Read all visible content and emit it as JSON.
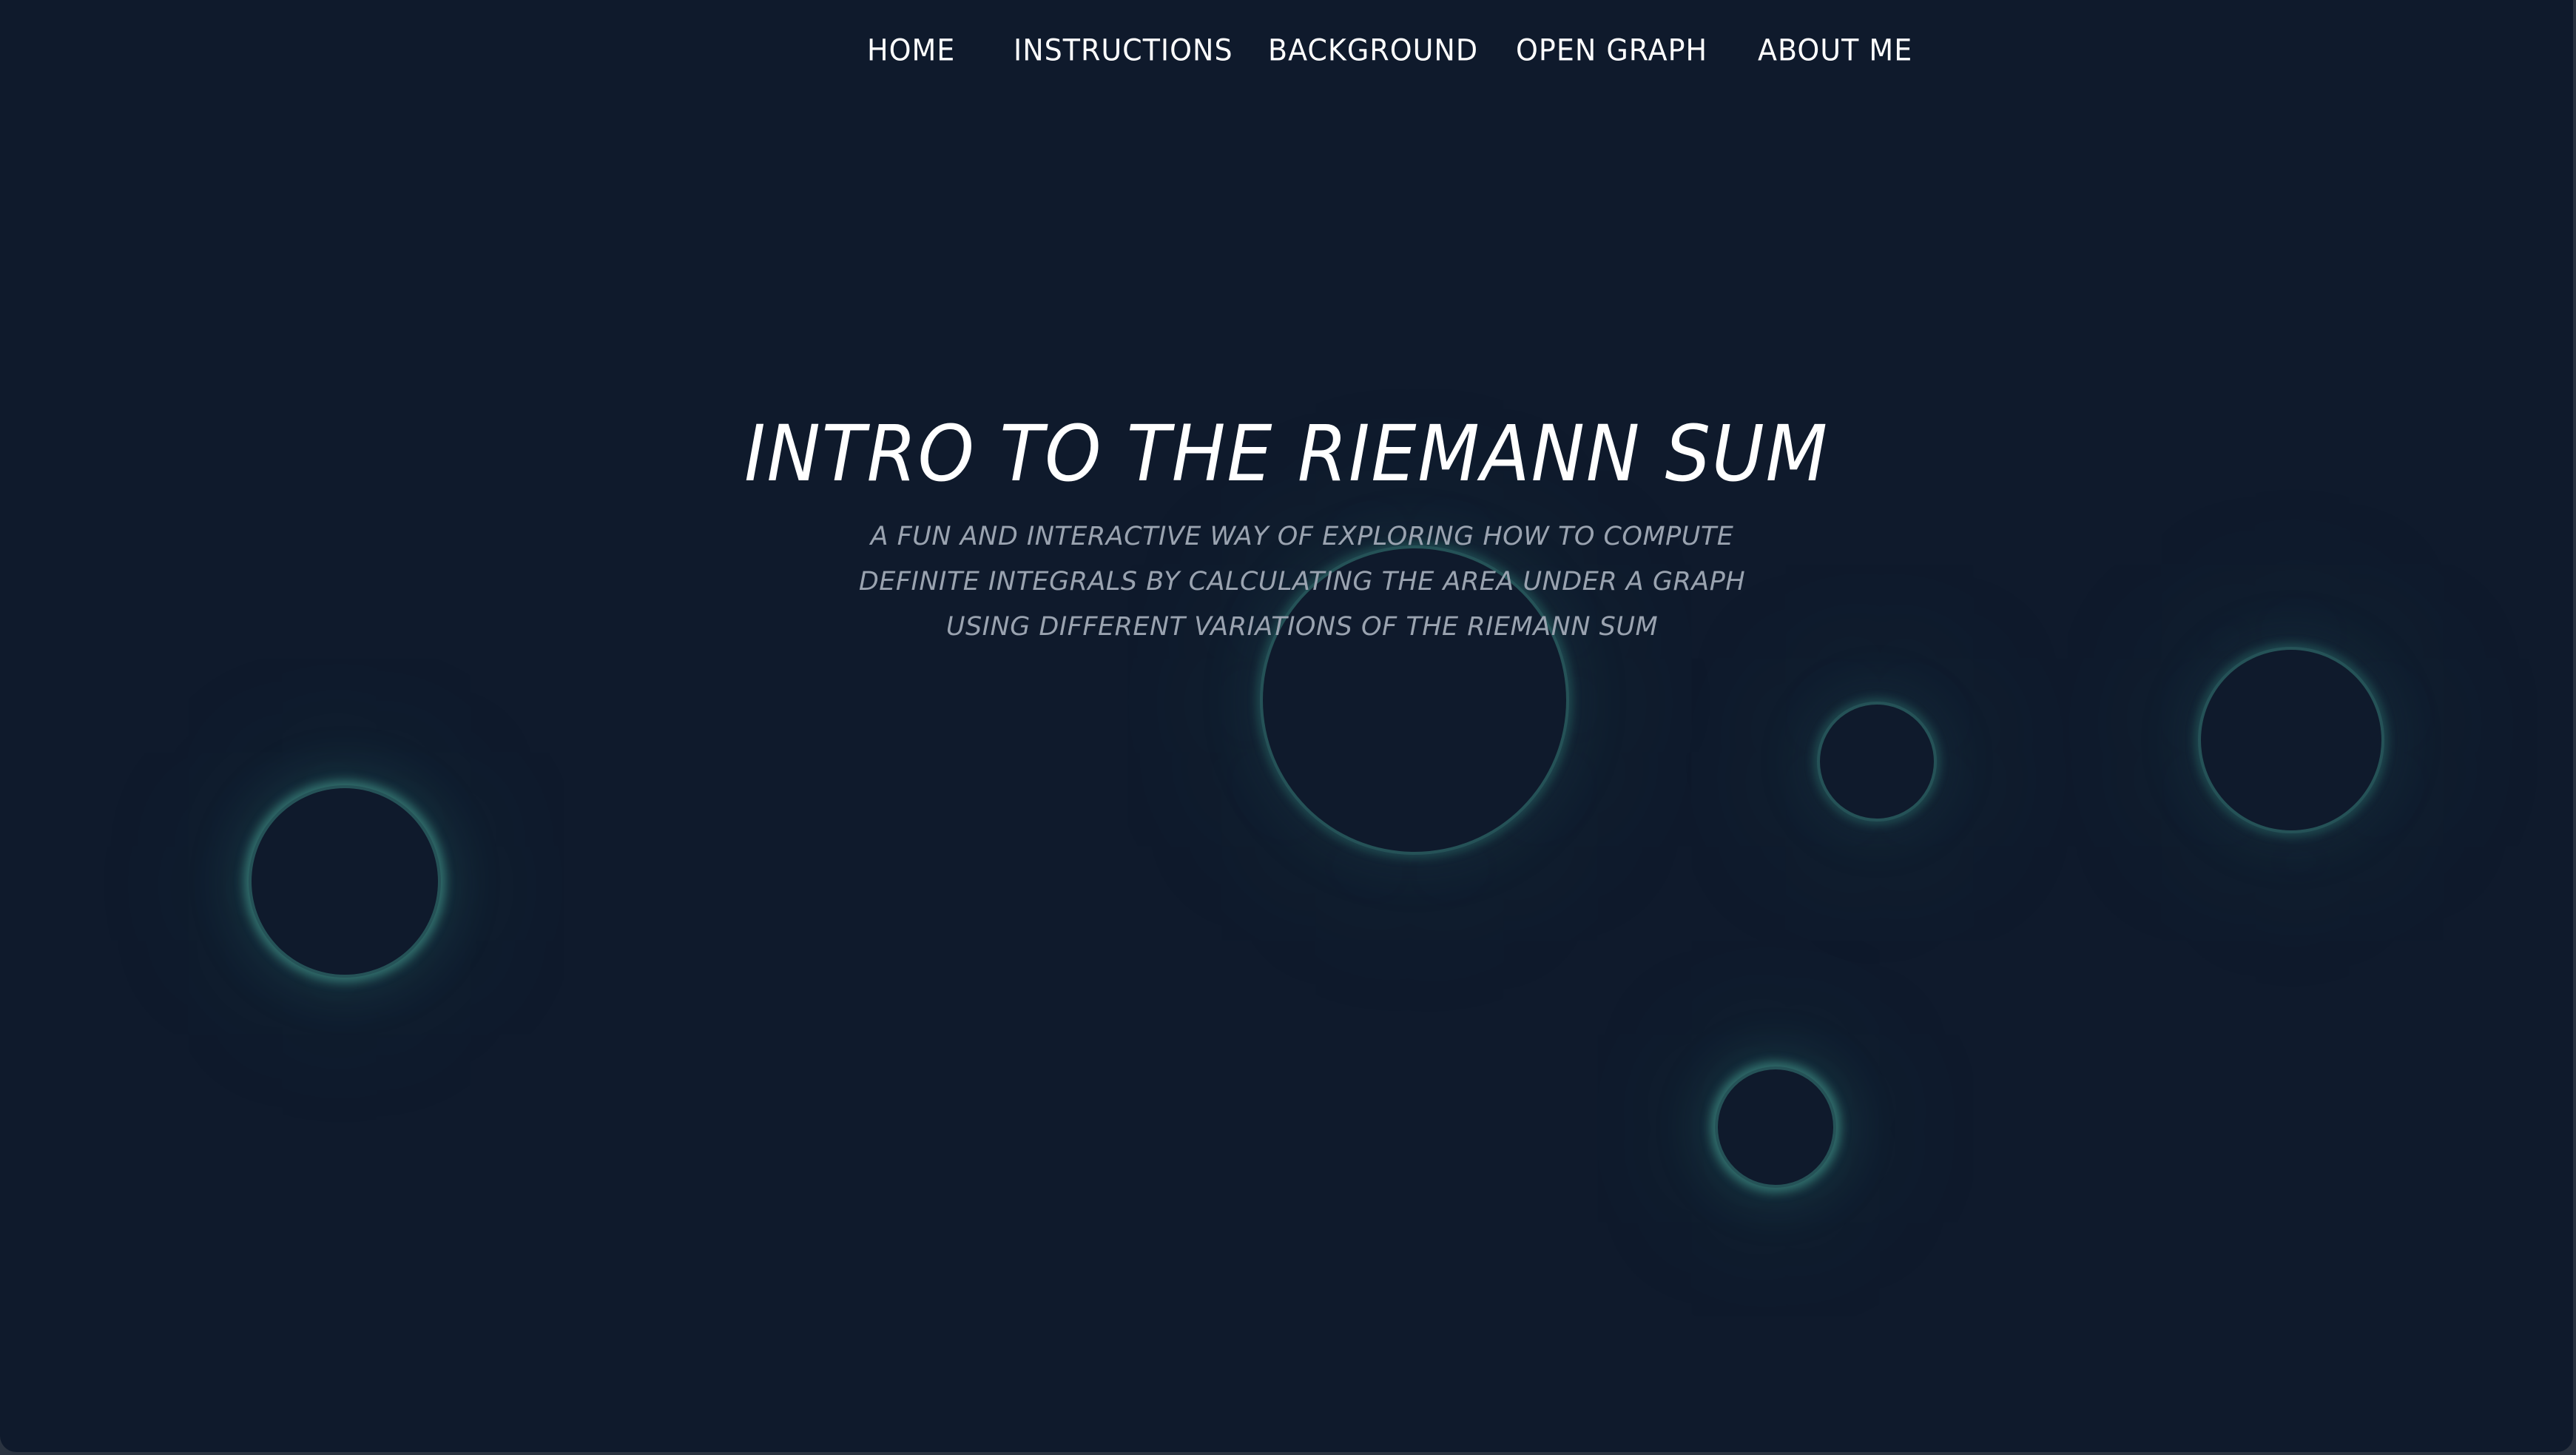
{
  "nav": {
    "items": [
      {
        "id": "home",
        "label": "HOME"
      },
      {
        "id": "instructions",
        "label": "INSTRUCTIONS"
      },
      {
        "id": "background",
        "label": "BACKGROUND"
      },
      {
        "id": "open_graph",
        "label": "OPEN GRAPH"
      },
      {
        "id": "about",
        "label": "ABOUT ME"
      }
    ]
  },
  "hero": {
    "title": "INTRO TO THE RIEMANN SUM",
    "subtitle": "A FUN AND INTERACTIVE WAY OF EXPLORING HOW TO COMPUTE DEFINITE INTEGRALS BY CALCULATING THE AREA UNDER A GRAPH USING DIFFERENT VARIATIONS OF THE RIEMANN SUM"
  },
  "colors": {
    "background": "#0f1a2c",
    "nav_text": "#ffffff",
    "title_text": "#ffffff",
    "subtitle_text": "#9aa3b0",
    "orb_glow": "#5ccdb4"
  }
}
